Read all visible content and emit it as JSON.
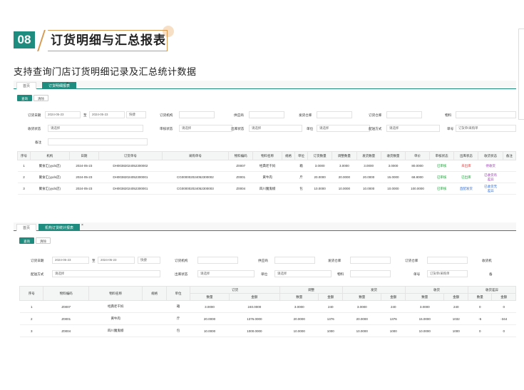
{
  "section": {
    "number": "08",
    "title": "订货明细与汇总报表",
    "description": "支持查询门店订货明细记录及汇总统计数据"
  },
  "shot1": {
    "tabs": [
      "首页",
      "订货明细报表"
    ],
    "close": "×",
    "buttons": {
      "query": "查询",
      "reset": "清除"
    },
    "filters": {
      "order_date": "订货日期",
      "date_from": "2024-05-23",
      "to": "至",
      "date_to": "2024-05-23",
      "quick": "快捷",
      "org": "订货机构",
      "supplier": "供应商",
      "warehouse": "发货仓库",
      "order_wh": "订货仓库",
      "goods": "物料",
      "receive_status": "收货状态",
      "audit_status": "审核状态",
      "out_status": "出库状态",
      "unit": "单位",
      "delivery": "配送方式",
      "doc_no": "单号",
      "placeholder": "请选择",
      "doc_placeholder": "订货单/采购单",
      "remark": "备注"
    },
    "columns": [
      "序号",
      "机构",
      "日期",
      "订货单号",
      "采购单号",
      "物料编码",
      "物料名称",
      "规格",
      "单位",
      "订货数量",
      "调整数量",
      "发货数量",
      "收货数量",
      "单价",
      "审核状态",
      "出库状态",
      "收货状态",
      "备注"
    ],
    "rows": [
      [
        "1",
        "聚食汇(yyds店)",
        "2024-05-23",
        "DH00382024052300002",
        "",
        "Z0007",
        "经典老干妈",
        "",
        "箱",
        "3.0000",
        "3.0000",
        "3.0000",
        "3.0000",
        "80.0000",
        "已审核",
        "未出库",
        "待收货"
      ],
      [
        "2",
        "聚食汇(yyds店)",
        "2024-05-23",
        "DH00382024052300001",
        "CG000002024052300002",
        "Z0001",
        "黄牛肉",
        "",
        "斤",
        "20.0000",
        "20.0000",
        "20.0000",
        "15.0000",
        "68.8000",
        "已审核",
        "已出库",
        "已收货有差异"
      ],
      [
        "3",
        "聚食汇(yyds店)",
        "2024-05-23",
        "DH00382024052300001",
        "CG000002024052300003",
        "Z0004",
        "四川魔鬼椒",
        "",
        "包",
        "10.0000",
        "10.0000",
        "10.0000",
        "10.0000",
        "100.0000",
        "已审核",
        "直配发货",
        "已收货无差异"
      ]
    ],
    "status_split": {
      "r2a": "已收货有",
      "r2b": "差异",
      "r3a": "已收货无",
      "r3b": "差异"
    }
  },
  "shot2": {
    "tabs": [
      "首页",
      "机构订货统计报表"
    ],
    "close": "×",
    "buttons": {
      "query": "查询",
      "reset": "清除"
    },
    "filters": {
      "order_date": "订货日期",
      "date_from": "2024-05-23",
      "to": "至",
      "date_to": "2024-05-23",
      "quick": "快捷",
      "org": "订货机构",
      "supplier": "供应商",
      "warehouse": "发货仓库",
      "order_wh": "订货仓库",
      "receive_org": "收货机",
      "delivery": "配送方式",
      "out_status": "出库状态",
      "unit": "单位",
      "goods": "物料",
      "doc_no": "单号",
      "remark": "备",
      "placeholder": "请选择",
      "doc_placeholder": "订货单/采购单"
    },
    "group_headers": [
      "订货",
      "调整",
      "发货",
      "收货",
      "收货差异"
    ],
    "columns": [
      "序号",
      "物料编码",
      "物料名称",
      "规格",
      "单位"
    ],
    "sub": [
      "数量",
      "金额"
    ],
    "rows": [
      [
        "1",
        "Z0007",
        "经典老干妈",
        "",
        "箱",
        "3.0000",
        "240.0000",
        "3.0000",
        "240",
        "3.0000",
        "240",
        "3.0000",
        "240",
        "0",
        "0"
      ],
      [
        "2",
        "Z0001",
        "黄牛肉",
        "",
        "斤",
        "20.0000",
        "1376.0000",
        "20.0000",
        "1376",
        "20.0000",
        "1376",
        "15.0000",
        "1032",
        "-5",
        "-344"
      ],
      [
        "3",
        "Z0004",
        "四川魔鬼椒",
        "",
        "包",
        "10.0000",
        "1000.0000",
        "10.0000",
        "1000",
        "10.0000",
        "1000",
        "10.0000",
        "1000",
        "0",
        "0"
      ]
    ]
  }
}
